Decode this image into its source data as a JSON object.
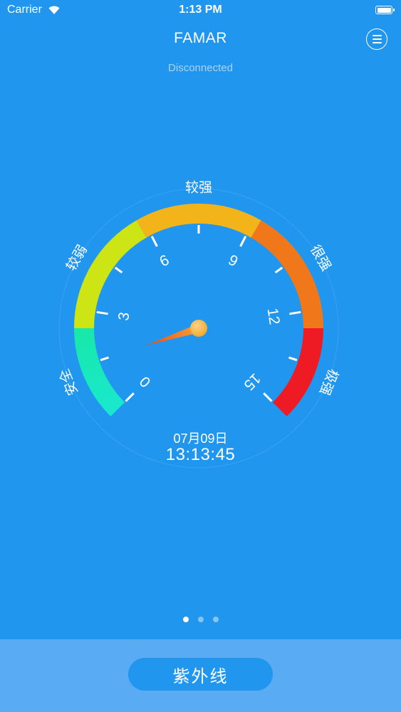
{
  "status_bar": {
    "carrier": "Carrier",
    "time": "1:13 PM",
    "wifi_icon": "wifi-icon",
    "battery_icon": "battery-icon"
  },
  "header": {
    "title": "FAMAR",
    "menu_icon": "menu-icon"
  },
  "connection": {
    "status": "Disconnected"
  },
  "gauge": {
    "min": 0,
    "max": 15,
    "value": 1.5,
    "tick_labels": [
      "0",
      "3",
      "6",
      "9",
      "12",
      "15"
    ],
    "zone_labels": [
      "安全",
      "较弱",
      "较强",
      "很强",
      "极强"
    ],
    "zone_colors": [
      "#19e6c2",
      "#cde415",
      "#f3b41a",
      "#f1781a",
      "#ee1b24"
    ]
  },
  "datetime": {
    "date": "07月09日",
    "time": "13:13:45"
  },
  "pagination": {
    "count": 3,
    "active": 0
  },
  "bottom": {
    "mode_label": "紫外线"
  }
}
